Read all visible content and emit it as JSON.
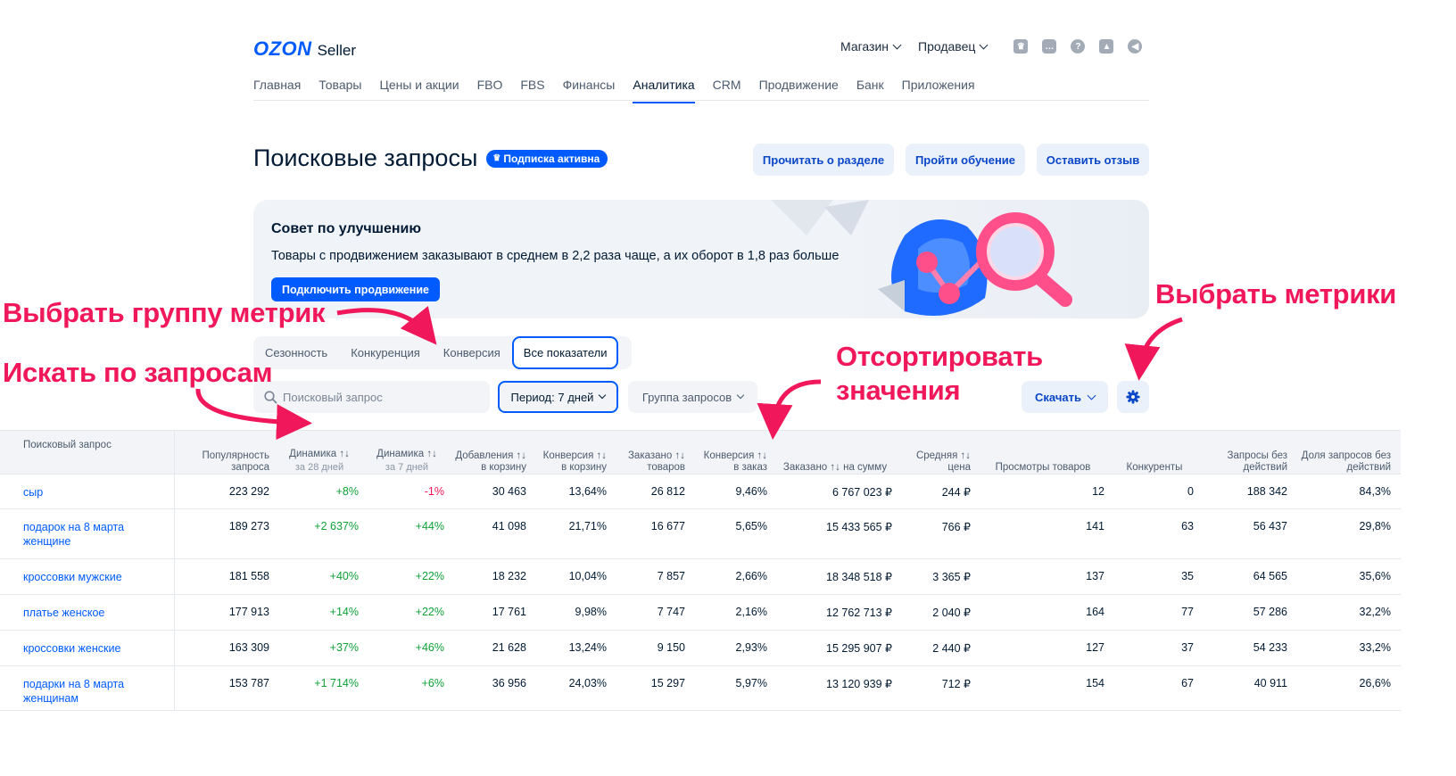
{
  "header": {
    "logo_brand": "OZON",
    "logo_product": "Seller",
    "store_menu": "Магазин",
    "seller_menu": "Продавец",
    "nav": [
      "Главная",
      "Товары",
      "Цены и акции",
      "FBO",
      "FBS",
      "Финансы",
      "Аналитика",
      "CRM",
      "Продвижение",
      "Банк",
      "Приложения"
    ],
    "active_nav": "Аналитика",
    "icons": [
      "crown-icon",
      "chat-icon",
      "help-icon",
      "graduation-cap-icon",
      "megaphone-icon"
    ]
  },
  "page": {
    "title": "Поисковые запросы",
    "badge": "Подписка активна",
    "buttons": [
      "Прочитать о разделе",
      "Пройти обучение",
      "Оставить отзыв"
    ]
  },
  "banner": {
    "title": "Совет по улучшению",
    "text": "Товары с продвижением заказывают в среднем в 2,2 раза чаще, а их оборот в 1,8 раз больше",
    "button": "Подключить продвижение"
  },
  "tabs": {
    "items": [
      "Сезонность",
      "Конкуренция",
      "Конверсия",
      "Все показатели"
    ],
    "selected": "Все показатели"
  },
  "filters": {
    "search_placeholder": "Поисковый запрос",
    "period": "Период: 7 дней",
    "group": "Группа запросов",
    "download": "Скачать"
  },
  "table": {
    "columns": [
      {
        "label": "Поисковый запрос",
        "sub": ""
      },
      {
        "label": "Популярность запроса",
        "sub": ""
      },
      {
        "label": "Динамика ↑↓",
        "sub": "за 28 дней"
      },
      {
        "label": "Динамика ↑↓",
        "sub": "за 7 дней"
      },
      {
        "label": "Добавления ↑↓ в корзину",
        "sub": ""
      },
      {
        "label": "Конверсия ↑↓ в корзину",
        "sub": ""
      },
      {
        "label": "Заказано ↑↓ товаров",
        "sub": ""
      },
      {
        "label": "Конверсия ↑↓ в заказ",
        "sub": ""
      },
      {
        "label": "Заказано ↑↓ на сумму",
        "sub": ""
      },
      {
        "label": "Средняя ↑↓ цена",
        "sub": ""
      },
      {
        "label": "Просмотры товаров",
        "sub": ""
      },
      {
        "label": "Конкуренты",
        "sub": ""
      },
      {
        "label": "Запросы без действий",
        "sub": ""
      },
      {
        "label": "Доля запросов без действий",
        "sub": ""
      }
    ],
    "rows": [
      [
        "сыр",
        "223 292",
        "+8%",
        "-1%",
        "30 463",
        "13,64%",
        "26 812",
        "9,46%",
        "6 767 023 ₽",
        "244 ₽",
        "12",
        "0",
        "188 342",
        "84,3%"
      ],
      [
        "подарок на 8 марта женщине",
        "189 273",
        "+2 637%",
        "+44%",
        "41 098",
        "21,71%",
        "16 677",
        "5,65%",
        "15 433 565 ₽",
        "766 ₽",
        "141",
        "63",
        "56 437",
        "29,8%"
      ],
      [
        "кроссовки мужские",
        "181 558",
        "+40%",
        "+22%",
        "18 232",
        "10,04%",
        "7 857",
        "2,66%",
        "18 348 518 ₽",
        "3 365 ₽",
        "137",
        "35",
        "64 565",
        "35,6%"
      ],
      [
        "платье женское",
        "177 913",
        "+14%",
        "+22%",
        "17 761",
        "9,98%",
        "7 747",
        "2,16%",
        "12 762 713 ₽",
        "2 040 ₽",
        "164",
        "77",
        "57 286",
        "32,2%"
      ],
      [
        "кроссовки женские",
        "163 309",
        "+37%",
        "+46%",
        "21 628",
        "13,24%",
        "9 150",
        "2,93%",
        "15 295 907 ₽",
        "2 440 ₽",
        "127",
        "37",
        "54 233",
        "33,2%"
      ],
      [
        "подарки на 8 марта женщинам",
        "153 787",
        "+1 714%",
        "+6%",
        "36 956",
        "24,03%",
        "15 297",
        "5,97%",
        "13 120 939 ₽",
        "712 ₽",
        "154",
        "67",
        "40 911",
        "26,6%"
      ]
    ]
  },
  "annotations": {
    "pick_group": "Выбрать группу метрик",
    "search": "Искать по запросам",
    "sort_line1": "Отсортировать",
    "sort_line2": "значения",
    "pick_metrics": "Выбрать метрики"
  },
  "colors": {
    "accent": "#005bff",
    "annotation": "#f0175a",
    "positive": "#10a137",
    "negative": "#f91155"
  }
}
